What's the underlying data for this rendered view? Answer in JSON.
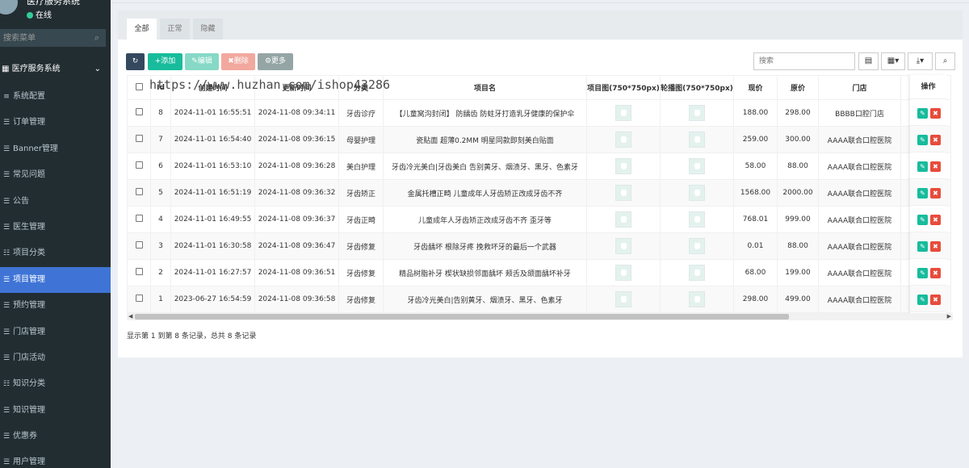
{
  "sidebar": {
    "app_name": "医疗服务系统",
    "status": "在线",
    "search_placeholder": "搜索菜单",
    "group_label": "医疗服务系统",
    "items": [
      {
        "label": "系统配置"
      },
      {
        "label": "订单管理"
      },
      {
        "label": "Banner管理"
      },
      {
        "label": "常见问题"
      },
      {
        "label": "公告"
      },
      {
        "label": "医生管理"
      },
      {
        "label": "项目分类"
      },
      {
        "label": "项目管理"
      },
      {
        "label": "预约管理"
      },
      {
        "label": "门店管理"
      },
      {
        "label": "门店活动"
      },
      {
        "label": "知识分类"
      },
      {
        "label": "知识管理"
      },
      {
        "label": "优惠券"
      },
      {
        "label": "用户管理"
      }
    ]
  },
  "tabs": [
    "全部",
    "正常",
    "隐藏"
  ],
  "toolbar": {
    "refresh": "",
    "add": "添加",
    "edit": "编辑",
    "delete": "删除",
    "more": "更多",
    "search_placeholder": "搜索"
  },
  "table": {
    "headers": [
      "Id",
      "创建时间",
      "更新时间",
      "分类",
      "项目名",
      "项目图(750*750px)",
      "轮播图(750*750px)",
      "现价",
      "原价",
      "门店"
    ],
    "op_header": "操作",
    "rows": [
      {
        "id": "8",
        "created": "2024-11-01 16:55:51",
        "updated": "2024-11-08 09:34:11",
        "category": "牙齿诊疗",
        "name": "【儿童窝沟封闭】 防龋齿 防蛀牙打造乳牙健康的保护伞",
        "price": "188.00",
        "orig": "298.00",
        "store": "BBBB口腔门店"
      },
      {
        "id": "7",
        "created": "2024-11-01 16:54:40",
        "updated": "2024-11-08 09:36:15",
        "category": "母婴护理",
        "name": "瓷贴面 超薄0.2MM 明星同款即刻美白贴面",
        "price": "259.00",
        "orig": "300.00",
        "store": "AAAA联合口腔医院"
      },
      {
        "id": "6",
        "created": "2024-11-01 16:53:10",
        "updated": "2024-11-08 09:36:28",
        "category": "美白护理",
        "name": "牙齿冷光美白|牙齿美白 告别黄牙、烟渍牙、黑牙、色素牙",
        "price": "58.00",
        "orig": "88.00",
        "store": "AAAA联合口腔医院"
      },
      {
        "id": "5",
        "created": "2024-11-01 16:51:19",
        "updated": "2024-11-08 09:36:32",
        "category": "牙齿矫正",
        "name": "金属托槽正畸 儿童成年人牙齿矫正改成牙齿不齐",
        "price": "1568.00",
        "orig": "2000.00",
        "store": "AAAA联合口腔医院"
      },
      {
        "id": "4",
        "created": "2024-11-01 16:49:55",
        "updated": "2024-11-08 09:36:37",
        "category": "牙齿正畸",
        "name": "儿童成年人牙齿矫正改成牙齿不齐 歪牙等",
        "price": "768.01",
        "orig": "999.00",
        "store": "AAAA联合口腔医院"
      },
      {
        "id": "3",
        "created": "2024-11-01 16:30:58",
        "updated": "2024-11-08 09:36:47",
        "category": "牙齿修复",
        "name": "牙齿龋坏 根除牙疼 挽救坏牙的最后一个武器",
        "price": "0.01",
        "orig": "88.00",
        "store": "AAAA联合口腔医院"
      },
      {
        "id": "2",
        "created": "2024-11-01 16:27:57",
        "updated": "2024-11-08 09:36:51",
        "category": "牙齿修复",
        "name": "精品树脂补牙 楔状缺损邻面龋坏 颊舌及颌面龋坏补牙",
        "price": "68.00",
        "orig": "199.00",
        "store": "AAAA联合口腔医院"
      },
      {
        "id": "1",
        "created": "2023-06-27 16:54:59",
        "updated": "2024-11-08 09:36:58",
        "category": "牙齿修复",
        "name": "牙齿冷光美白|告别黄牙、烟渍牙、黑牙、色素牙",
        "price": "298.00",
        "orig": "499.00",
        "store": "AAAA联合口腔医院"
      }
    ]
  },
  "footer": "显示第 1 到第 8 条记录，总共 8 条记录",
  "watermark": "https://www.huzhan.com/ishop43286",
  "colors": {
    "sidebar": "#222d32",
    "active": "#3f74d6",
    "success": "#18bc9c",
    "danger": "#e74c3c",
    "dark": "#34495e",
    "gray": "#95a5a6"
  }
}
